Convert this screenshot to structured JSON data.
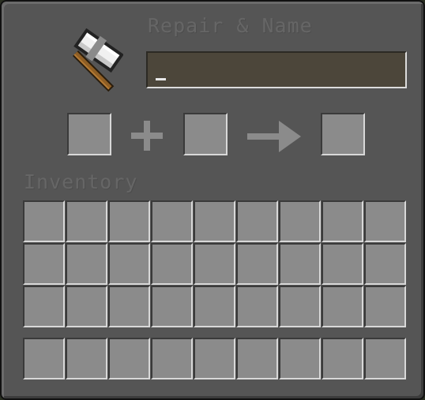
{
  "title": "Repair & Name",
  "name_field": {
    "value": "",
    "placeholder": ""
  },
  "slots": {
    "input_left": {
      "item": ""
    },
    "input_right": {
      "item": ""
    },
    "output": {
      "item": ""
    }
  },
  "inventory": {
    "label": "Inventory",
    "main_rows": 3,
    "hotbar_rows": 1,
    "columns": 9
  },
  "icons": {
    "anvil": "iron-hammer-icon",
    "combine": "plus-icon",
    "result": "arrow-right-icon"
  },
  "colors": {
    "panel": "#555555",
    "slot": "#8b8b8b",
    "text_field": "#4c463a",
    "label_text": "#666666"
  }
}
